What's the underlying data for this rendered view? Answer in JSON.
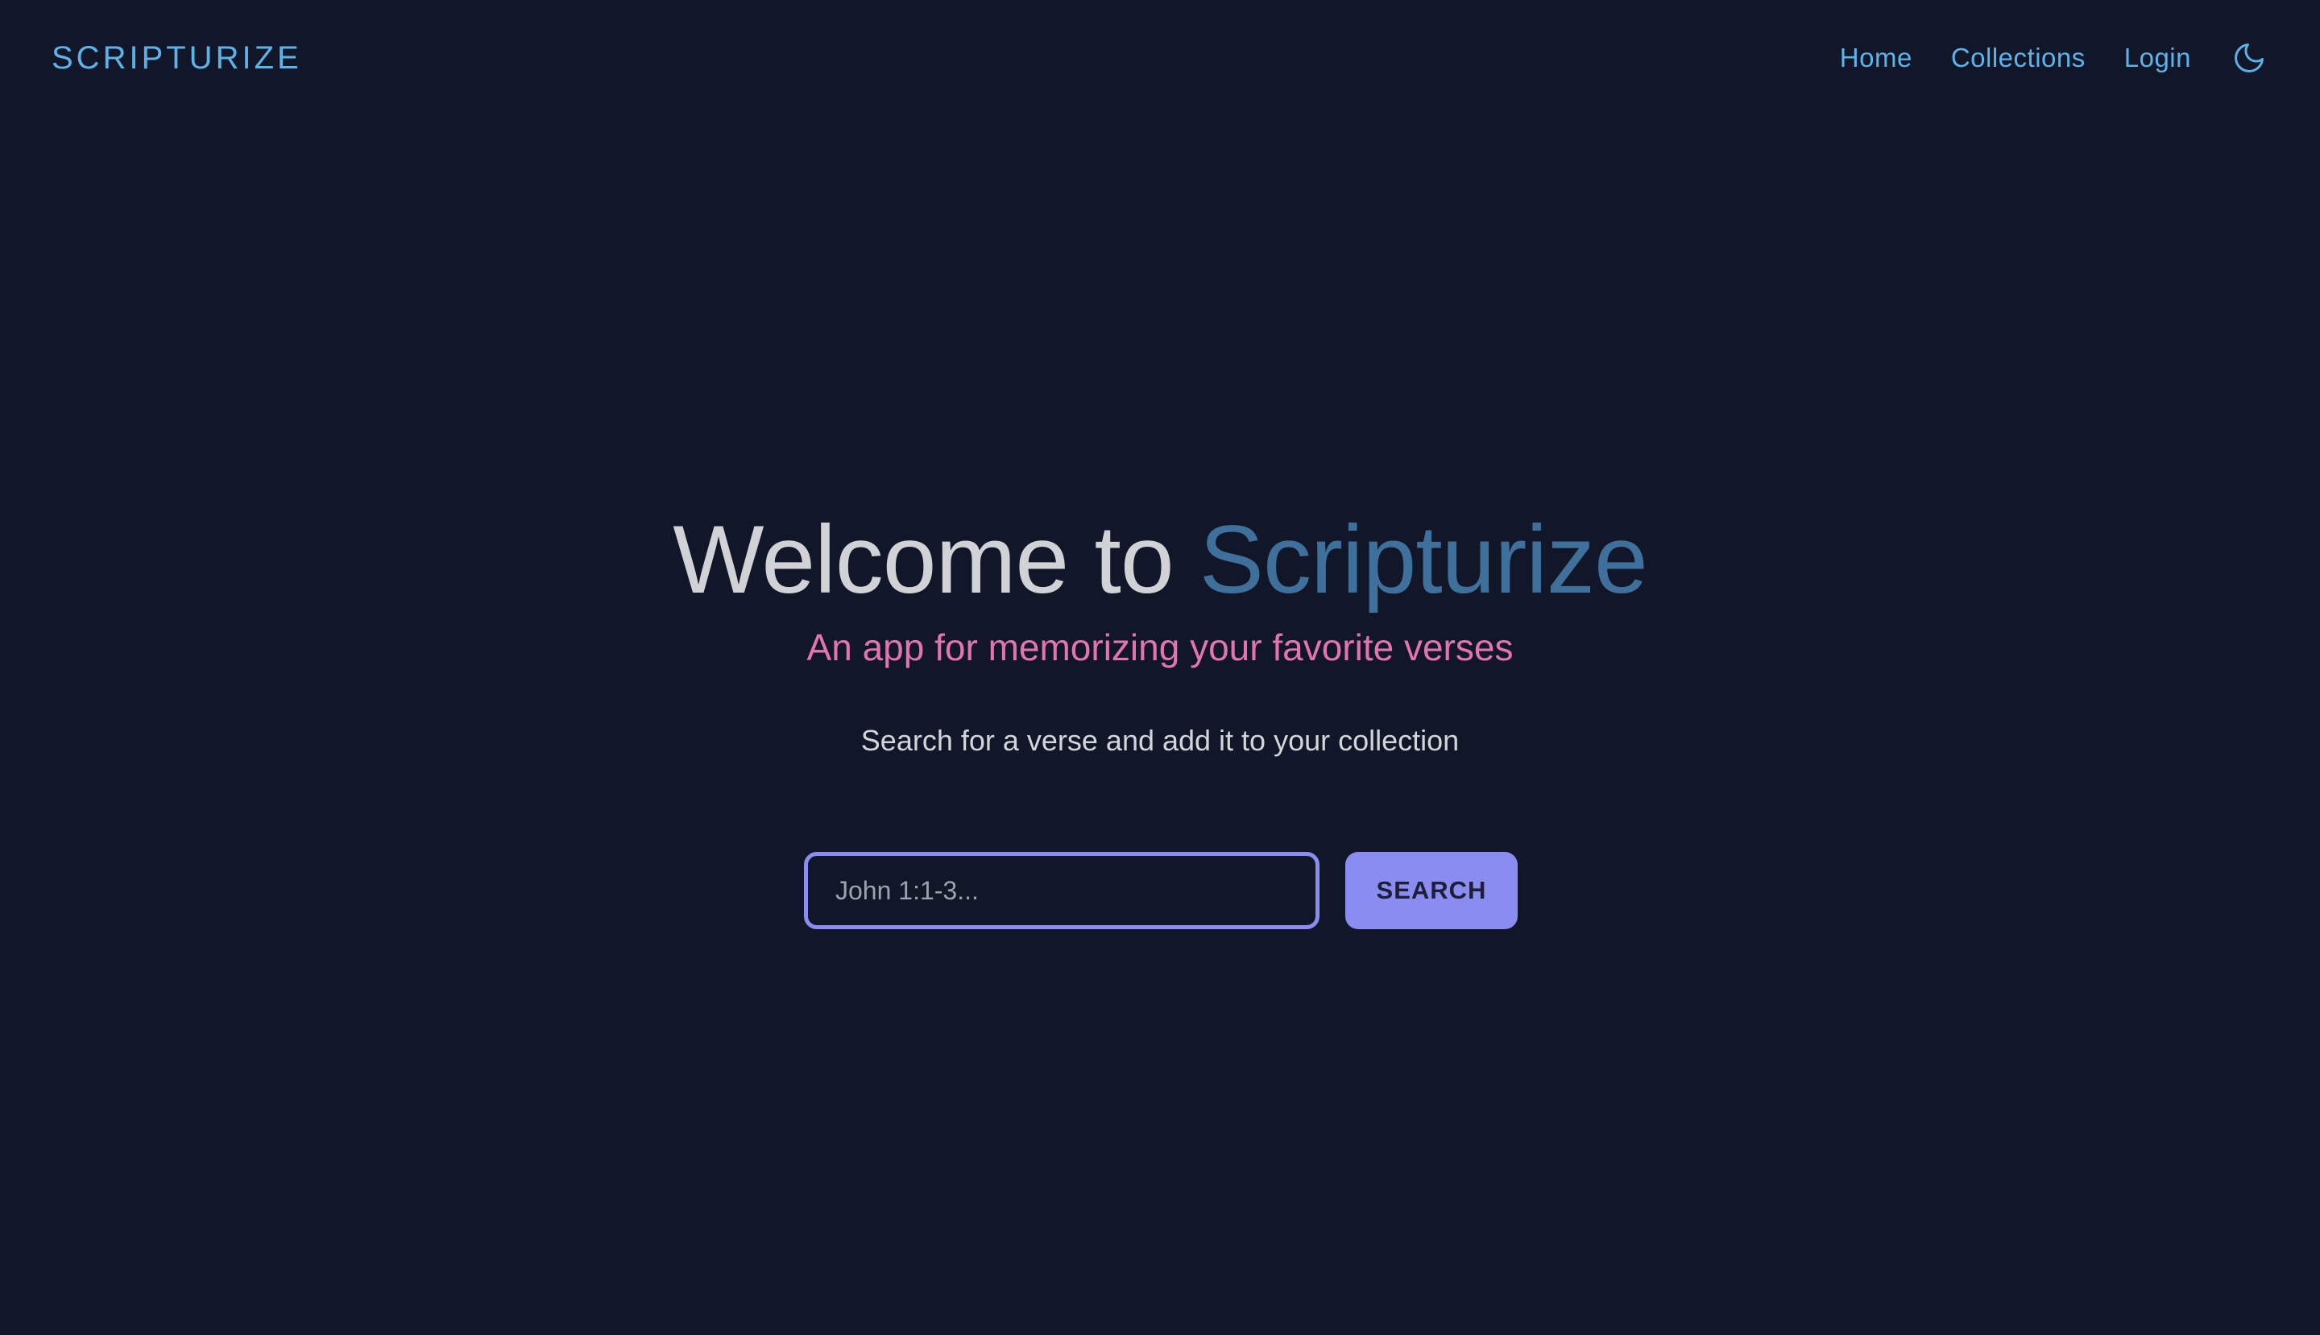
{
  "app": {
    "brand": "SCRIPTURIZE"
  },
  "nav": {
    "items": [
      {
        "label": "Home"
      },
      {
        "label": "Collections"
      },
      {
        "label": "Login"
      }
    ],
    "theme_toggle_icon": "moon-icon"
  },
  "hero": {
    "title_prefix": "Welcome to ",
    "title_accent": "Scripturize",
    "subtitle": "An app for memorizing your favorite verses",
    "hint": "Search for a verse and add it to your collection"
  },
  "search": {
    "placeholder": "John 1:1-3...",
    "value": "",
    "button_label": "SEARCH"
  },
  "colors": {
    "background": "#111729",
    "brand": "#5cb3ea",
    "title_accent": "#3f709b",
    "subtitle": "#e275ad",
    "button": "#8b8cf2"
  }
}
